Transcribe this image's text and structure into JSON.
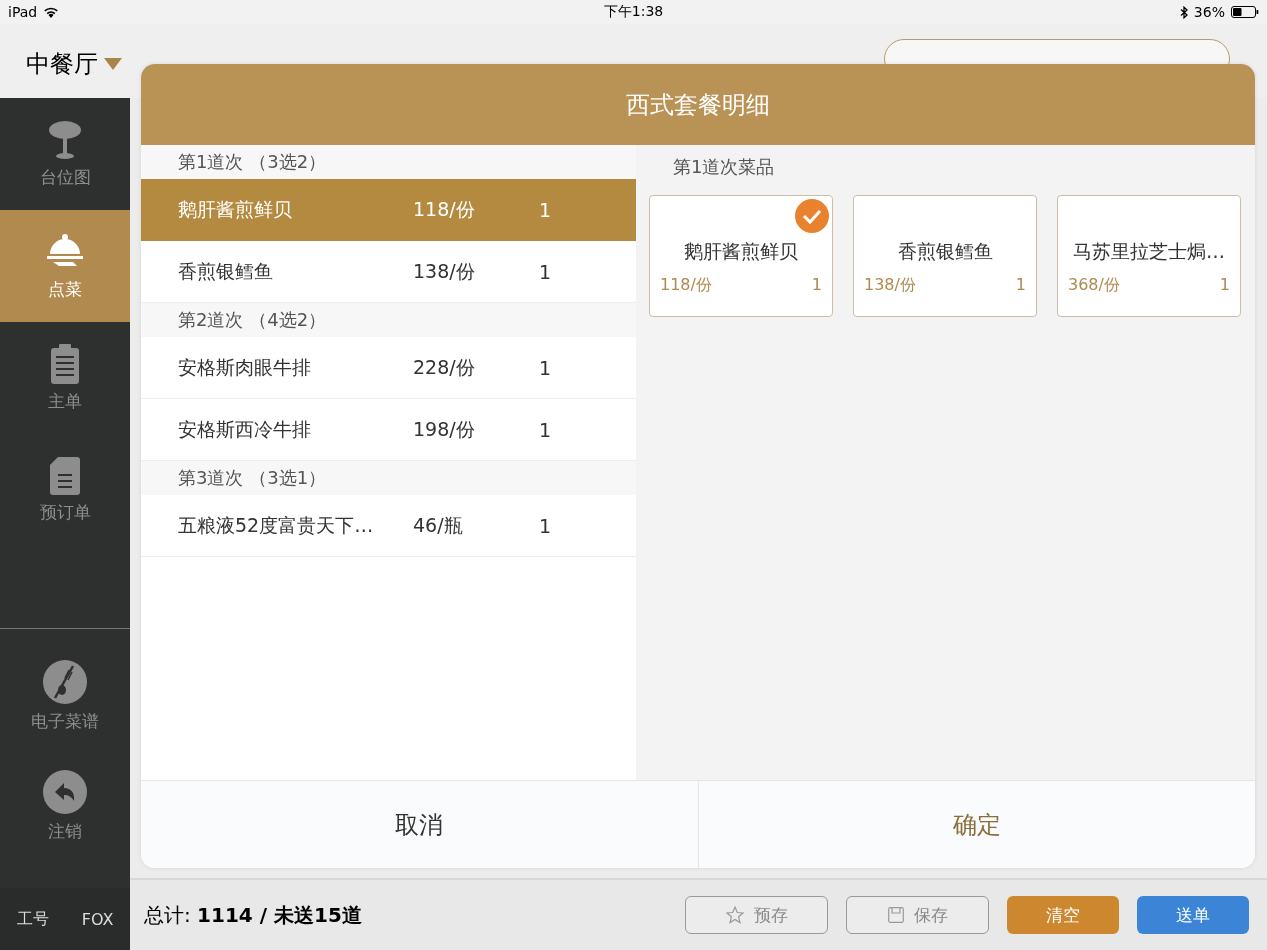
{
  "status_bar": {
    "device": "iPad",
    "time": "下午1:38",
    "battery": "36%"
  },
  "header": {
    "restaurant": "中餐厅"
  },
  "sidebar": {
    "items": [
      {
        "label": "台位图",
        "selected": false
      },
      {
        "label": "点菜",
        "selected": true
      },
      {
        "label": "主单",
        "selected": false
      },
      {
        "label": "预订单",
        "selected": false
      }
    ],
    "bottom_items": [
      {
        "label": "电子菜谱",
        "selected": false
      },
      {
        "label": "注销",
        "selected": false
      }
    ],
    "user": {
      "label": "工号",
      "name": "FOX"
    }
  },
  "order_bar": {
    "total": "总计: **1114 / 未送15道**",
    "buttons": [
      {
        "label": "预存",
        "kind": "outline"
      },
      {
        "label": "保存",
        "kind": "outline"
      },
      {
        "label": "清空",
        "kind": "filled",
        "color": "#cd882f"
      },
      {
        "label": "送单",
        "kind": "filled",
        "color": "#3c85d6"
      }
    ]
  },
  "dialog": {
    "title": "西式套餐明细",
    "courses": [
      {
        "header": "第1道次 （3选2）",
        "items": [
          {
            "name": "鹅肝酱煎鲜贝",
            "price": "118/份",
            "qty": "1",
            "selected": true
          },
          {
            "name": "香煎银鳕鱼",
            "price": "138/份",
            "qty": "1",
            "selected": false
          }
        ]
      },
      {
        "header": "第2道次 （4选2）",
        "items": [
          {
            "name": "安格斯肉眼牛排",
            "price": "228/份",
            "qty": "1",
            "selected": false
          },
          {
            "name": "安格斯西冷牛排",
            "price": "198/份",
            "qty": "1",
            "selected": false
          }
        ]
      },
      {
        "header": "第3道次 （3选1）",
        "items": [
          {
            "name": "五粮液52度富贵天下…",
            "price": "46/瓶",
            "qty": "1",
            "selected": false
          }
        ]
      }
    ],
    "detail": {
      "title": "第1道次菜品",
      "dishes": [
        {
          "name": "鹅肝酱煎鲜贝",
          "price": "118/份",
          "qty": "1",
          "checked": true
        },
        {
          "name": "香煎银鳕鱼",
          "price": "138/份",
          "qty": "1",
          "checked": false
        },
        {
          "name": "马苏里拉芝士焗…",
          "price": "368/份",
          "qty": "1",
          "checked": false
        }
      ]
    },
    "cancel": "取消",
    "confirm": "确定"
  }
}
